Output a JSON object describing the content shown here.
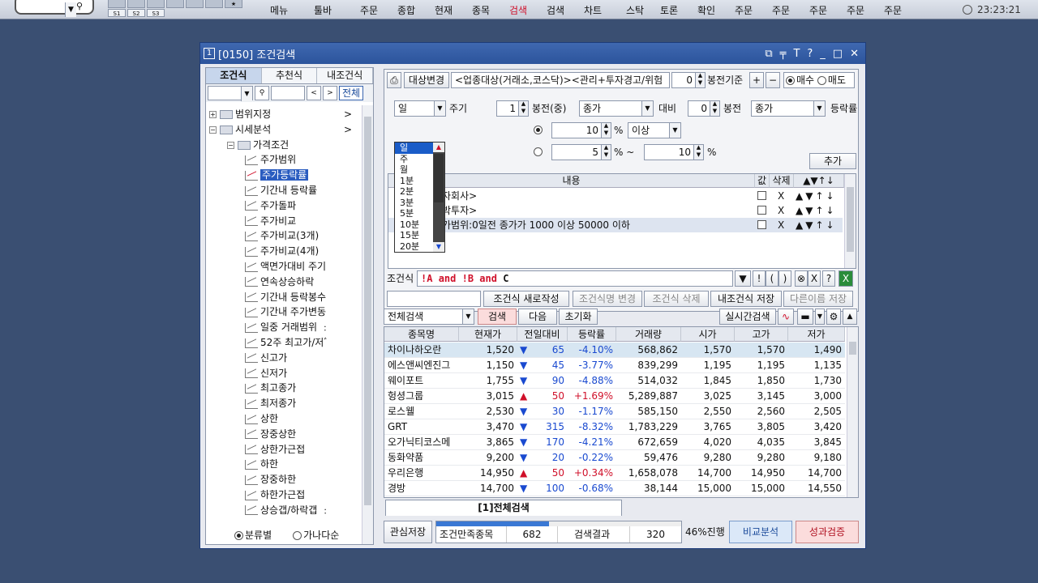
{
  "toolbar": {
    "buttons": [
      "메뉴",
      "툴바",
      "주문",
      "종합",
      "현재",
      "종목",
      "검색",
      "검색",
      "차트",
      "스탁",
      "토론",
      "확인",
      "주문",
      "주문",
      "주문",
      "주문",
      "주문"
    ],
    "active_index": 6,
    "s_tabs": [
      "S1",
      "S2",
      "S3"
    ],
    "clock": "23:23:21"
  },
  "window": {
    "number": "1",
    "title": "[0150] 조건검색",
    "controls": [
      "⧉",
      "╤",
      "T",
      "?",
      "_",
      "□",
      "✕"
    ]
  },
  "left": {
    "tabs": [
      "조건식",
      "추천식",
      "내조건식"
    ],
    "all_button": "전체",
    "tree": [
      {
        "label": "범위지정",
        "level": 0,
        "type": "folder",
        "toggle": "+"
      },
      {
        "label": "시세분석",
        "level": 0,
        "type": "folder",
        "toggle": "−"
      },
      {
        "label": "가격조건",
        "level": 1,
        "type": "folder",
        "toggle": "−"
      },
      {
        "label": "주가범위",
        "level": 2,
        "type": "leaf"
      },
      {
        "label": "주가등락률",
        "level": 2,
        "type": "leaf",
        "selected": true
      },
      {
        "label": "기간내 등락률",
        "level": 2,
        "type": "leaf"
      },
      {
        "label": "주가돌파",
        "level": 2,
        "type": "leaf"
      },
      {
        "label": "주가비교",
        "level": 2,
        "type": "leaf"
      },
      {
        "label": "주가비교(3개)",
        "level": 2,
        "type": "leaf"
      },
      {
        "label": "주가비교(4개)",
        "level": 2,
        "type": "leaf"
      },
      {
        "label": "액면가대비 주기",
        "level": 2,
        "type": "leaf"
      },
      {
        "label": "연속상승하락",
        "level": 2,
        "type": "leaf"
      },
      {
        "label": "기간내 등락봉수",
        "level": 2,
        "type": "leaf"
      },
      {
        "label": "기간내 주가변동",
        "level": 2,
        "type": "leaf"
      },
      {
        "label": "일중 거래범위 ﹕",
        "level": 2,
        "type": "leaf"
      },
      {
        "label": "52주 최고가/저ﾞ",
        "level": 2,
        "type": "leaf"
      },
      {
        "label": "신고가",
        "level": 2,
        "type": "leaf"
      },
      {
        "label": "신저가",
        "level": 2,
        "type": "leaf"
      },
      {
        "label": "최고종가",
        "level": 2,
        "type": "leaf"
      },
      {
        "label": "최저종가",
        "level": 2,
        "type": "leaf"
      },
      {
        "label": "상한",
        "level": 2,
        "type": "leaf"
      },
      {
        "label": "장중상한",
        "level": 2,
        "type": "leaf"
      },
      {
        "label": "상한가근접",
        "level": 2,
        "type": "leaf"
      },
      {
        "label": "하한",
        "level": 2,
        "type": "leaf"
      },
      {
        "label": "장중하한",
        "level": 2,
        "type": "leaf"
      },
      {
        "label": "하한가근접",
        "level": 2,
        "type": "leaf"
      },
      {
        "label": "상승갭/하락갭 ﹕",
        "level": 2,
        "type": "leaf"
      }
    ],
    "radio": [
      "분류별",
      "가나다순"
    ]
  },
  "target": {
    "button": "대상변경",
    "text": "<업종대상(거래소,코스닥)><관리+투자경고/위험",
    "candle_value": "0",
    "candle_label": "봉전기준",
    "plus": "+",
    "minus": "−",
    "buy": "매수",
    "sell": "매도"
  },
  "period": {
    "value": "일",
    "label": "주기",
    "options": [
      "일",
      "주",
      "월",
      "1분",
      "2분",
      "3분",
      "5분",
      "10분",
      "15분",
      "20분"
    ],
    "selected": "일"
  },
  "params": {
    "bong1_value": "1",
    "bong1_label": "봉전(중)",
    "price1": "종가",
    "vs_label": "대비",
    "bong2_value": "0",
    "bong2_label": "봉전",
    "price2": "종가",
    "rate_label": "등락률",
    "r1_value": "10",
    "pct1": "%",
    "r1_op": "이상",
    "r2_from": "5",
    "r2_pct": "% ~",
    "r2_to": "10",
    "r2_pct2": "%",
    "add_button": "추가"
  },
  "cond_table": {
    "headers": [
      "내용",
      "값",
      "삭제"
    ],
    "arrow_header": "▲▼↑↓",
    "rows": [
      {
        "text": "자회사>",
        "del": "X",
        "arrows": "▲▼↑↓"
      },
      {
        "text": "박투자>",
        "del": "X",
        "arrows": "▲▼↑↓"
      },
      {
        "text": "가범위:0일전 종가가 1000 이상 50000 이하",
        "del": "X",
        "arrows": "▲▼↑↓"
      }
    ]
  },
  "formula": {
    "label": "조건식",
    "text_parts": [
      "!A",
      "and",
      "!B",
      "and",
      "C"
    ],
    "buttons": [
      "▼",
      "!",
      "(",
      ")",
      "⊗",
      "X",
      "?"
    ]
  },
  "cond_actions": [
    "조건식 새로작성",
    "조건식명 변경",
    "조건식 삭제",
    "내조건식 저장",
    "다른이름 저장"
  ],
  "search_bar": {
    "select": "전체검색",
    "search": "검색",
    "next": "다음",
    "reset": "초기화",
    "realtime": "실시간검색"
  },
  "results": {
    "headers": [
      "종목명",
      "현재가",
      "전일대비",
      "등락률",
      "거래량",
      "시가",
      "고가",
      "저가"
    ],
    "rows": [
      {
        "name": "차이나하오란",
        "price": "1,520",
        "dir": "dn",
        "change": "65",
        "rate": "-4.10%",
        "volume": "568,862",
        "open": "1,570",
        "high": "1,570",
        "low": "1,490"
      },
      {
        "name": "에스앤씨엔진그",
        "price": "1,150",
        "dir": "dn",
        "change": "45",
        "rate": "-3.77%",
        "volume": "839,299",
        "open": "1,195",
        "high": "1,195",
        "low": "1,135"
      },
      {
        "name": "웨이포트",
        "price": "1,755",
        "dir": "dn",
        "change": "90",
        "rate": "-4.88%",
        "volume": "514,032",
        "open": "1,845",
        "high": "1,850",
        "low": "1,730"
      },
      {
        "name": "헝셩그룹",
        "price": "3,015",
        "dir": "up",
        "change": "50",
        "rate": "+1.69%",
        "volume": "5,289,887",
        "open": "3,025",
        "high": "3,145",
        "low": "3,000"
      },
      {
        "name": "로스웰",
        "price": "2,530",
        "dir": "dn",
        "change": "30",
        "rate": "-1.17%",
        "volume": "585,150",
        "open": "2,550",
        "high": "2,560",
        "low": "2,505"
      },
      {
        "name": "GRT",
        "price": "3,470",
        "dir": "dn",
        "change": "315",
        "rate": "-8.32%",
        "volume": "1,783,229",
        "open": "3,765",
        "high": "3,805",
        "low": "3,420"
      },
      {
        "name": "오가닉티코스메",
        "price": "3,865",
        "dir": "dn",
        "change": "170",
        "rate": "-4.21%",
        "volume": "672,659",
        "open": "4,020",
        "high": "4,035",
        "low": "3,845"
      },
      {
        "name": "동화약품",
        "price": "9,200",
        "dir": "dn",
        "change": "20",
        "rate": "-0.22%",
        "volume": "59,476",
        "open": "9,280",
        "high": "9,280",
        "low": "9,180"
      },
      {
        "name": "우리은행",
        "price": "14,950",
        "dir": "up",
        "change": "50",
        "rate": "+0.34%",
        "volume": "1,658,078",
        "open": "14,700",
        "high": "14,950",
        "low": "14,700"
      },
      {
        "name": "경방",
        "price": "14,700",
        "dir": "dn",
        "change": "100",
        "rate": "-0.68%",
        "volume": "38,144",
        "open": "15,000",
        "high": "15,000",
        "low": "14,550"
      }
    ]
  },
  "result_tab": "[1]전체검색",
  "status": {
    "save": "관심저장",
    "matched_label": "조건만족종목",
    "matched": "682",
    "result_label": "검색결과",
    "result": "320",
    "progress_text": "46%진행",
    "progress": 0.46,
    "compare": "비교분석",
    "verify": "성과검증"
  },
  "colors": {
    "accent": "#2a5cc0",
    "up": "#d0102a",
    "down": "#1a4ad0",
    "title": "#2c549c"
  }
}
